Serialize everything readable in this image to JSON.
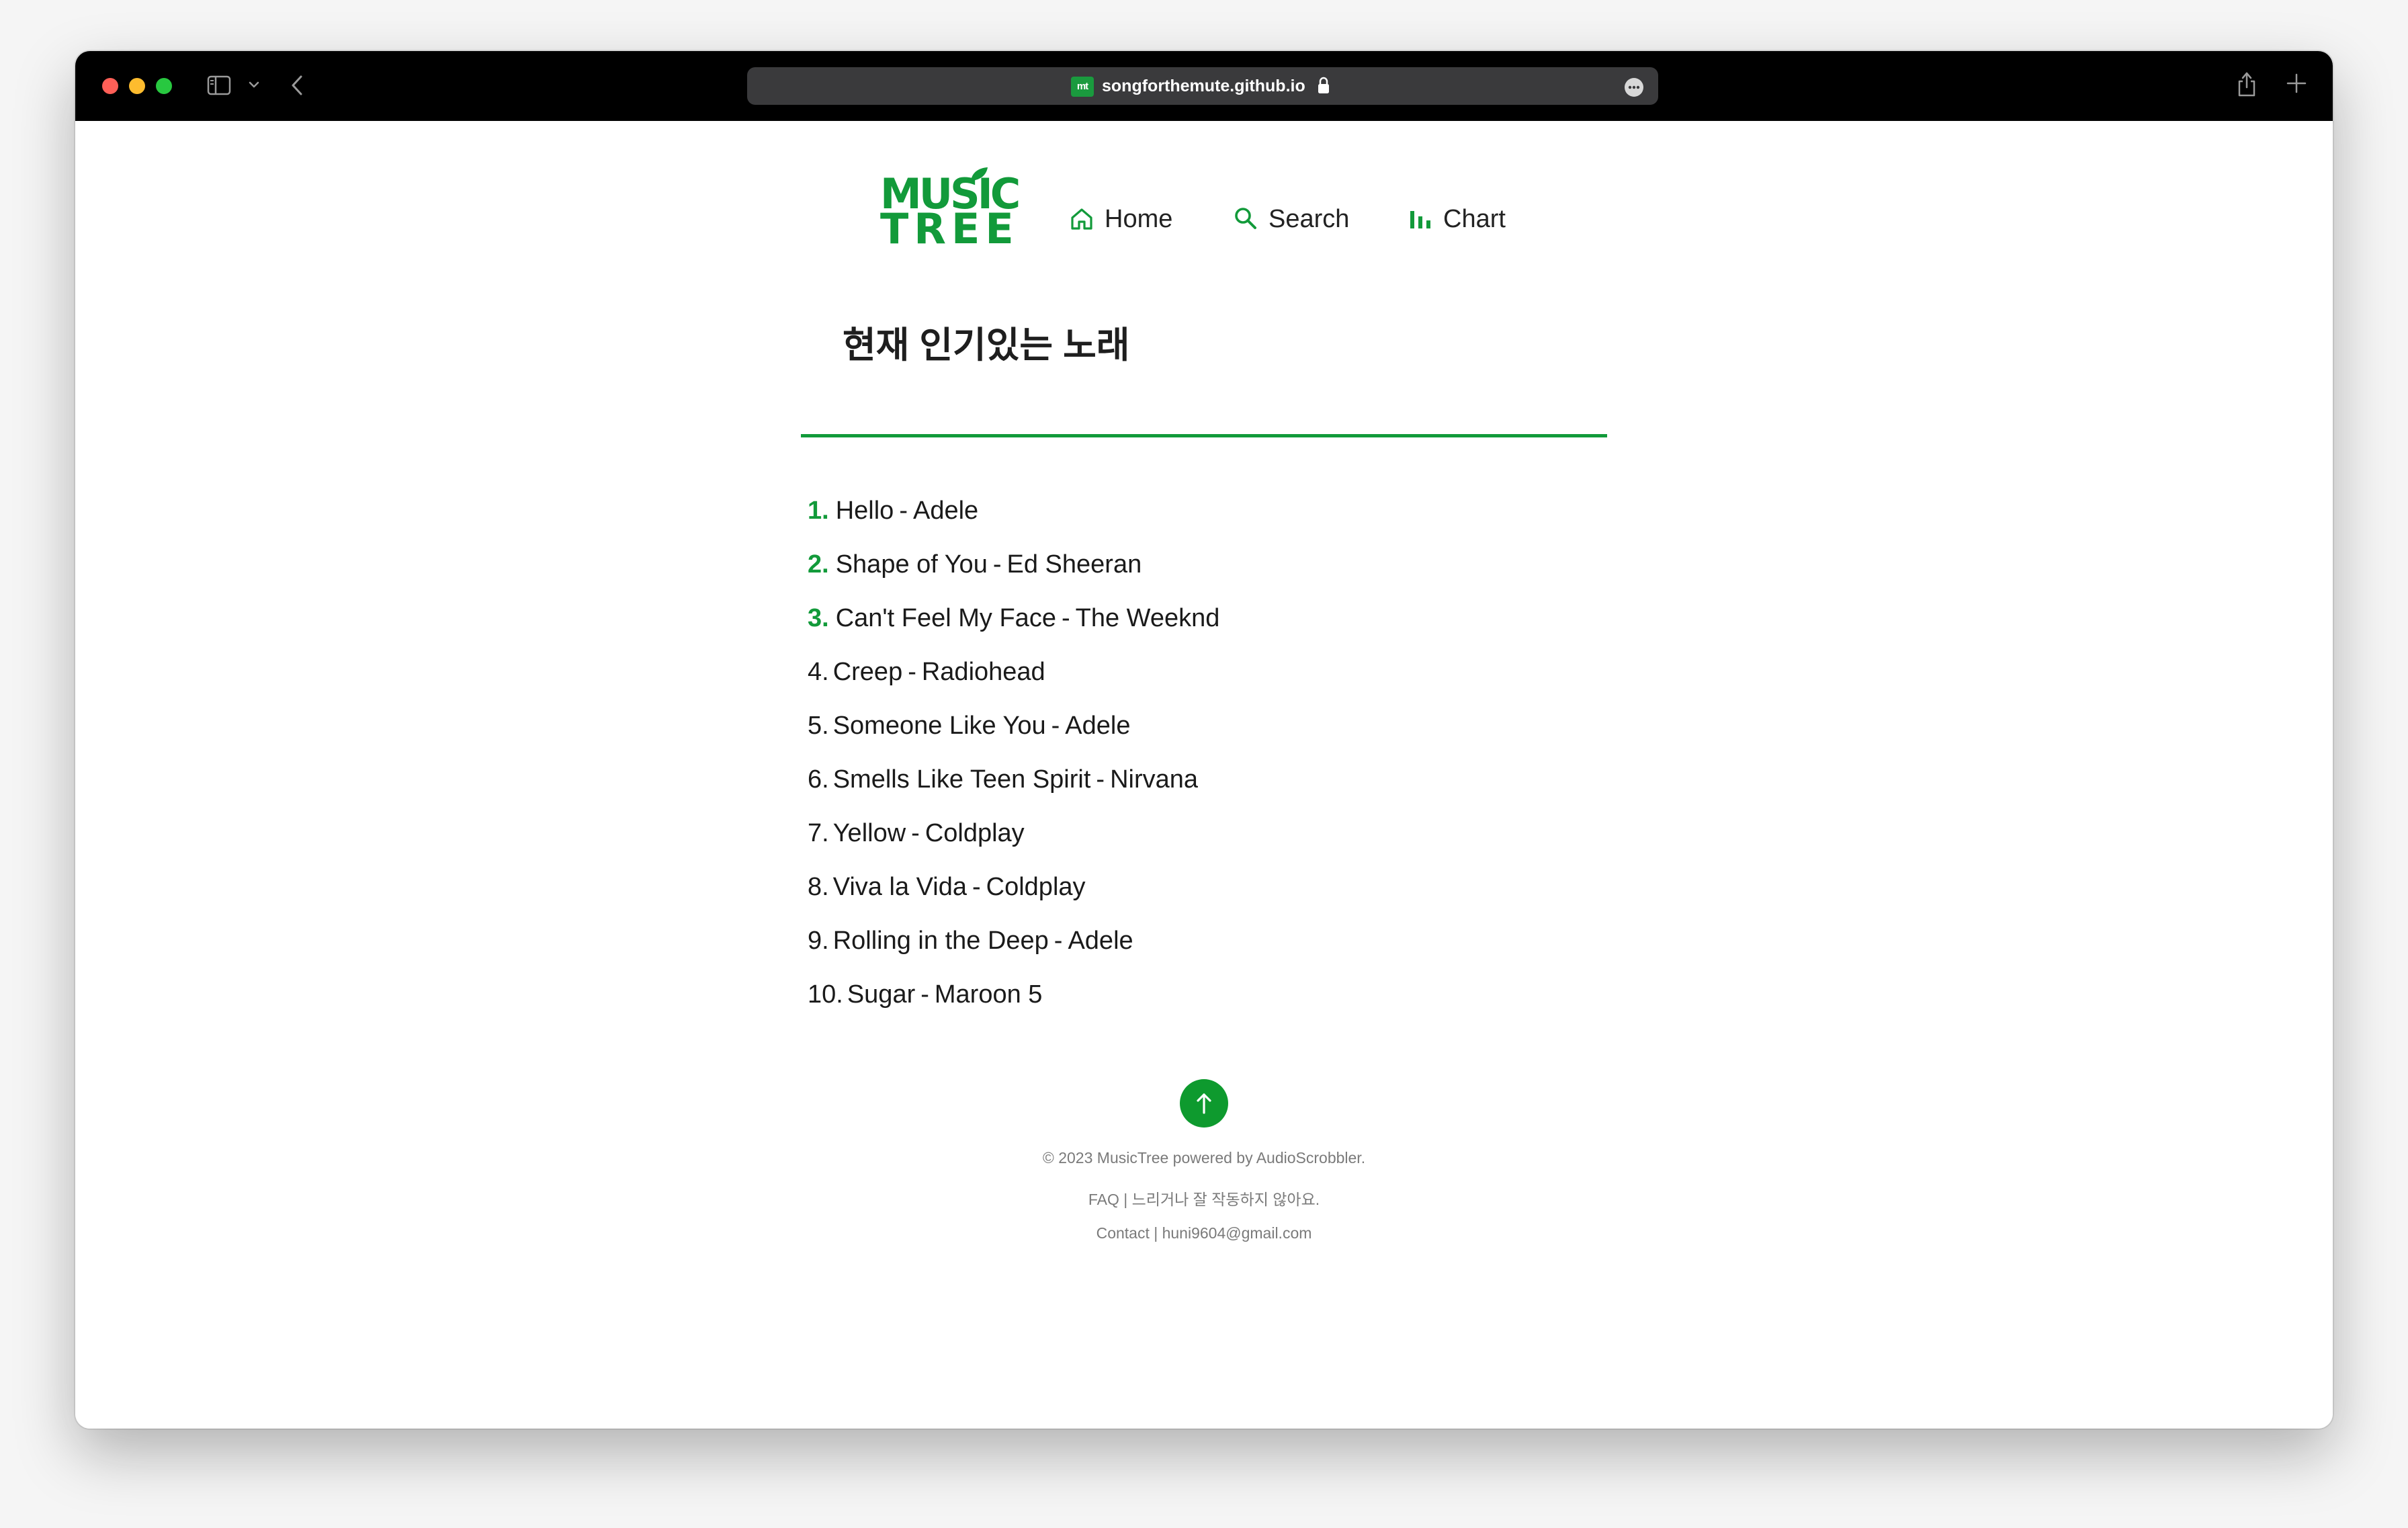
{
  "browser": {
    "url": "songforthemute.github.io",
    "favicon_text": "mt"
  },
  "header": {
    "logo_line1": "MUSIC",
    "logo_line2": "TREE",
    "nav": [
      {
        "label": "Home"
      },
      {
        "label": "Search"
      },
      {
        "label": "Chart"
      }
    ]
  },
  "main": {
    "title": "현재 인기있는 노래",
    "separator": "-",
    "songs": [
      {
        "rank": "1.",
        "title": "Hello",
        "artist": "Adele"
      },
      {
        "rank": "2.",
        "title": "Shape of You",
        "artist": "Ed Sheeran"
      },
      {
        "rank": "3.",
        "title": "Can't Feel My Face",
        "artist": "The Weeknd"
      },
      {
        "rank": "4.",
        "title": "Creep",
        "artist": "Radiohead"
      },
      {
        "rank": "5.",
        "title": "Someone Like You",
        "artist": "Adele"
      },
      {
        "rank": "6.",
        "title": "Smells Like Teen Spirit",
        "artist": "Nirvana"
      },
      {
        "rank": "7.",
        "title": "Yellow",
        "artist": "Coldplay"
      },
      {
        "rank": "8.",
        "title": "Viva la Vida",
        "artist": "Coldplay"
      },
      {
        "rank": "9.",
        "title": "Rolling in the Deep",
        "artist": "Adele"
      },
      {
        "rank": "10.",
        "title": "Sugar",
        "artist": "Maroon 5"
      }
    ]
  },
  "footer": {
    "copyright": "© 2023 MusicTree powered by AudioScrobbler.",
    "faq": "FAQ | 느리거나 잘 작동하지 않아요.",
    "contact": "Contact | huni9604@gmail.com"
  },
  "colors": {
    "accent": "#129a3a",
    "titlebar": "#000000",
    "addressbar": "#3a3a3c"
  }
}
